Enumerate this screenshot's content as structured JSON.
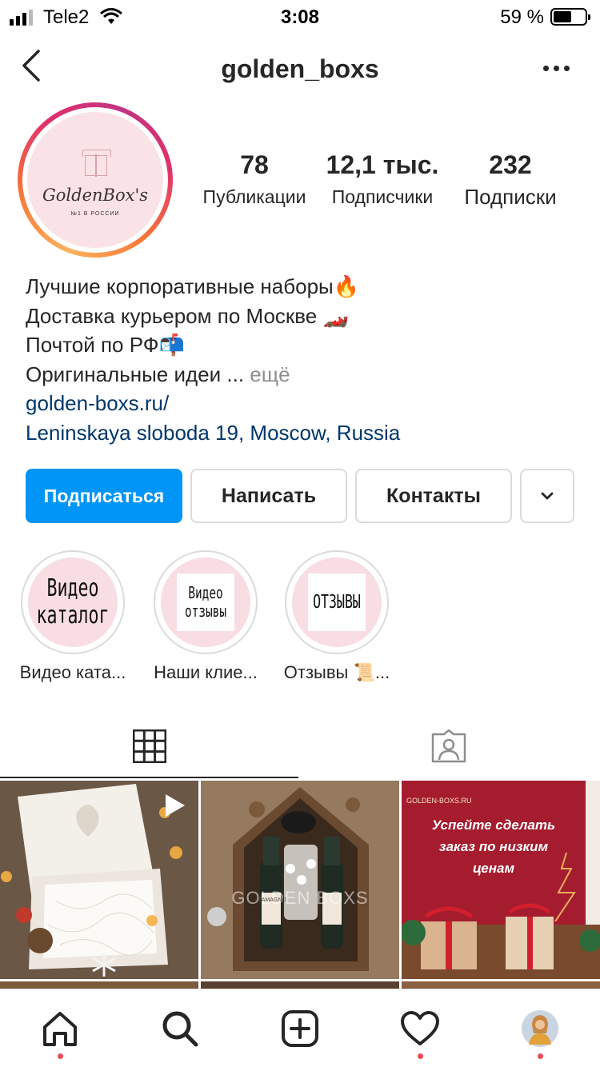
{
  "status_bar": {
    "carrier": "Tele2",
    "time": "3:08",
    "battery_percent": "59 %",
    "battery_level": 0.59
  },
  "header": {
    "username": "golden_boxs",
    "back_icon": "chevron-left-icon",
    "more_icon": "more-horizontal-icon"
  },
  "profile": {
    "avatar_brand": "GoldenBox's",
    "avatar_tagline": "№1 В РОССИИ",
    "stats": [
      {
        "value": "78",
        "label": "Публикации"
      },
      {
        "value": "12,1 тыс.",
        "label": "Подписчики"
      },
      {
        "value": "232",
        "label": "Подписки"
      }
    ],
    "bio_lines": [
      "Лучшие корпоративные наборы🔥",
      "Доставка курьером по Москве 🏎️",
      "Почтой по РФ📬",
      "Оригинальные идеи ..."
    ],
    "bio_more": "ещё",
    "website": "golden-boxs.ru/",
    "address": "Leninskaya sloboda 19, Moscow, Russia"
  },
  "actions": {
    "follow": "Подписаться",
    "message": "Написать",
    "contacts": "Контакты",
    "dropdown_icon": "chevron-down-icon"
  },
  "highlights": [
    {
      "cover_text_lines": [
        "Видео",
        "каталог"
      ],
      "label": "Видео ката..."
    },
    {
      "cover_text_lines": [
        "Видео",
        "отзывы"
      ],
      "label": "Наши клие..."
    },
    {
      "cover_text_lines": [
        "ОТЗЫВЫ"
      ],
      "label": "Отзывы 📜..."
    }
  ],
  "tabs": [
    {
      "icon": "grid-icon",
      "active": true
    },
    {
      "icon": "tagged-person-icon",
      "active": false
    }
  ],
  "posts": [
    {
      "type": "video",
      "alt_icon": "play-icon"
    },
    {
      "type": "image",
      "watermark": "GOLDEN BOXS",
      "bottle_label": "TAMAGNO"
    },
    {
      "type": "image",
      "site_label": "GOLDEN-BOXS.RU",
      "headline_lines": [
        "Успейте сделать",
        "заказ по низким",
        "ценам"
      ]
    }
  ],
  "colors": {
    "accent": "#0095f6",
    "link": "#00376b",
    "muted": "#8e8e8e",
    "notification_dot": "#ed4956"
  },
  "bottom_nav": [
    {
      "icon": "home-icon",
      "has_dot": true
    },
    {
      "icon": "search-icon",
      "has_dot": false
    },
    {
      "icon": "new-post-icon",
      "has_dot": false
    },
    {
      "icon": "activity-heart-icon",
      "has_dot": true
    },
    {
      "icon": "profile-avatar-icon",
      "has_dot": true
    }
  ]
}
